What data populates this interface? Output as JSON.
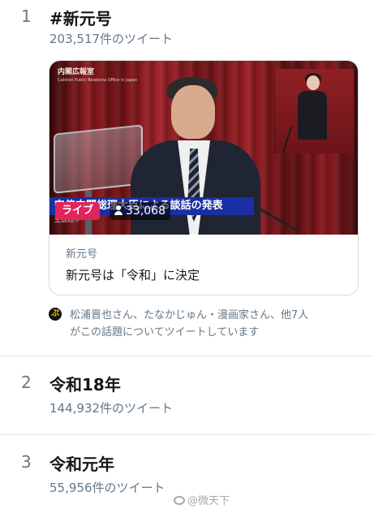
{
  "trends": [
    {
      "rank": "1",
      "title": "#新元号",
      "count": "203,517件のツイート"
    },
    {
      "rank": "2",
      "title": "令和18年",
      "count": "144,932件のツイート"
    },
    {
      "rank": "3",
      "title": "令和元年",
      "count": "55,956件のツイート"
    }
  ],
  "card": {
    "logo": "内閣広報室",
    "logo_sub": "Cabinet Public Relations Office in Japan",
    "caption": "安倍内閣総理大臣による談話の発表",
    "caption_small": "生放送中",
    "live_label": "ライブ",
    "viewer_count": "33,068",
    "source": "新元号",
    "title": "新元号は「令和」に決定"
  },
  "context": {
    "line1": "松浦晋也さん、たなかじゅん・漫画家さん、他7人",
    "line2": "がこの話題についてツイートしています",
    "icon_text": "ぷ"
  },
  "watermark": "@微天下",
  "colors": {
    "live": "#e0245e",
    "caption_bg": "#1a2fa3",
    "muted": "#657786",
    "divider": "#e1e8ed"
  }
}
